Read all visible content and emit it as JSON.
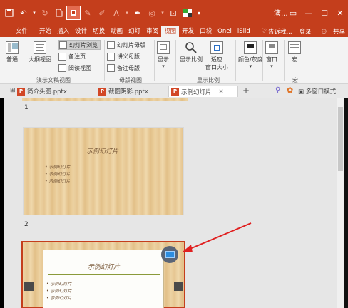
{
  "window": {
    "title": "演...",
    "controls": [
      "▭",
      "—",
      "☐",
      "✕"
    ]
  },
  "qat": {
    "icons": [
      "save-icon",
      "undo-icon",
      "redo-icon",
      "new-icon",
      "slideshow-icon",
      "format-painter-icon",
      "pen-icon",
      "text-icon",
      "brush-icon",
      "shape-icon",
      "select-icon",
      "color-icon",
      "more-icon"
    ]
  },
  "tabs": [
    "文件",
    "开始",
    "插入",
    "设计",
    "切换",
    "动画",
    "幻灯",
    "审阅",
    "视图",
    "开发",
    "口袋",
    "Onel",
    "iSlid"
  ],
  "active_tab": "视图",
  "tab_right": {
    "tell_me": "告诉我...",
    "login": "登录",
    "share": "共享"
  },
  "ribbon": {
    "presentation_views": {
      "normal": "普通",
      "outline": "大纲视图",
      "slide_sorter": "幻灯片浏览",
      "notes_page": "备注页",
      "reading_view": "阅读视图",
      "label": "演示文稿视图"
    },
    "master_views": {
      "slide_master": "幻灯片母版",
      "handout_master": "讲义母版",
      "notes_master": "备注母版",
      "label": "母版视图"
    },
    "show": {
      "label": "显示"
    },
    "zoom": {
      "zoom": "显示比例",
      "fit": "适应\n窗口大小",
      "label": "显示比例"
    },
    "color": {
      "label": "颜色/灰度"
    },
    "window": {
      "label": "窗口"
    },
    "macros": {
      "macro": "宏",
      "label": "宏"
    }
  },
  "doc_tabs": [
    {
      "name": "简介头图.pptx",
      "active": false
    },
    {
      "name": "截图阴影.pptx",
      "active": false
    },
    {
      "name": "示例幻灯片",
      "active": true
    }
  ],
  "doc_tab_right": {
    "multi_window": "多窗口模式"
  },
  "slides": [
    {
      "number": "1",
      "title": "示例幻灯片",
      "bullets": [
        "示例幻灯片",
        "示例幻灯片",
        "示例幻灯片"
      ]
    },
    {
      "number": "2",
      "title": "示例幻灯片",
      "bullets": [
        "示例幻灯片",
        "示例幻灯片",
        "示例幻灯片"
      ]
    }
  ],
  "colors": {
    "accent": "#c43e1c",
    "ribbon_bg": "#f3f3f3",
    "canvas_bg": "#e6e6e6",
    "selection": "#c43e1c",
    "arrow": "#e02020"
  }
}
